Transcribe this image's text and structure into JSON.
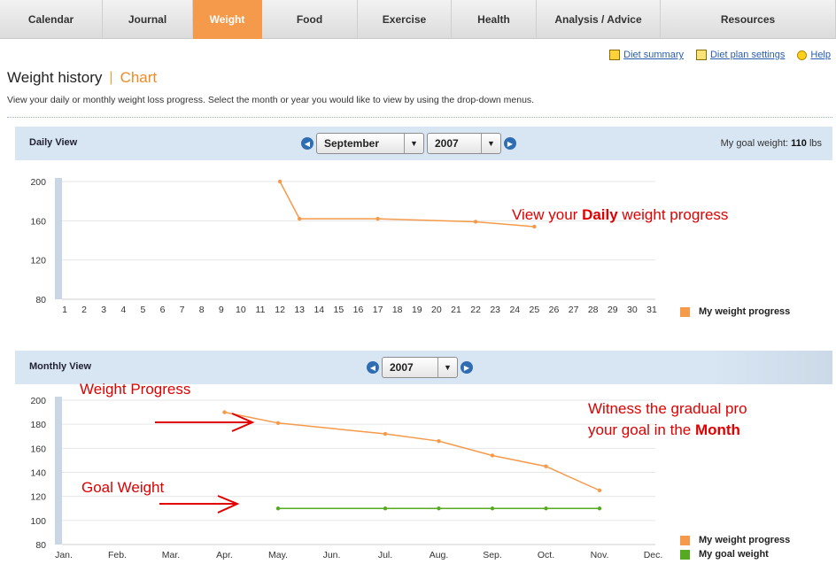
{
  "nav": {
    "tabs": [
      {
        "label": "Calendar",
        "active": false
      },
      {
        "label": "Journal",
        "active": false
      },
      {
        "label": "Weight",
        "active": true
      },
      {
        "label": "Food",
        "active": false
      },
      {
        "label": "Exercise",
        "active": false
      },
      {
        "label": "Health",
        "active": false
      },
      {
        "label": "Analysis / Advice",
        "active": false
      },
      {
        "label": "Resources",
        "active": false
      }
    ]
  },
  "links": {
    "diet_summary": "Diet summary",
    "diet_plan_settings": "Diet plan settings",
    "help": "Help"
  },
  "page": {
    "title": "Weight history",
    "subtitle": "Chart",
    "intro": "View your daily or monthly weight loss progress. Select the month or year you would like to view by using the drop-down menus."
  },
  "daily": {
    "label": "Daily View",
    "month": "September",
    "year": "2007",
    "goal_prefix": "My goal weight:",
    "goal_value": "110",
    "goal_unit": "lbs",
    "legend": "My weight progress"
  },
  "monthly": {
    "label": "Monthly View",
    "year": "2007",
    "legend_progress": "My weight progress",
    "legend_goal": "My goal weight"
  },
  "annotations": {
    "daily_pre": "View your ",
    "daily_bold": "Daily",
    "daily_post": " weight progress",
    "weight_progress": "Weight Progress",
    "goal_weight": "Goal Weight",
    "monthly_line1": "Witness the gradual pro",
    "monthly_pre": "your goal in the ",
    "monthly_bold": "Month"
  },
  "colors": {
    "progress": "#f59a4a",
    "goal": "#55aa22",
    "active_tab": "#f59a4a"
  },
  "chart_data": [
    {
      "type": "line",
      "name": "daily",
      "x_ticks": [
        1,
        2,
        3,
        4,
        5,
        6,
        7,
        8,
        9,
        10,
        11,
        12,
        13,
        14,
        15,
        16,
        17,
        18,
        19,
        20,
        21,
        22,
        23,
        24,
        25,
        26,
        27,
        28,
        29,
        30,
        31
      ],
      "y_ticks": [
        80,
        120,
        160,
        200
      ],
      "ylim": [
        80,
        200
      ],
      "series": [
        {
          "name": "My weight progress",
          "points": [
            [
              12,
              200
            ],
            [
              13,
              162
            ],
            [
              17,
              162
            ],
            [
              22,
              159
            ],
            [
              25,
              154
            ]
          ]
        }
      ]
    },
    {
      "type": "line",
      "name": "monthly",
      "categories": [
        "Jan.",
        "Feb.",
        "Mar.",
        "Apr.",
        "May.",
        "Jun.",
        "Jul.",
        "Aug.",
        "Sep.",
        "Oct.",
        "Nov.",
        "Dec."
      ],
      "y_ticks": [
        80,
        100,
        120,
        140,
        160,
        180,
        200
      ],
      "ylim": [
        80,
        200
      ],
      "series": [
        {
          "name": "My weight progress",
          "points": [
            [
              4,
              190
            ],
            [
              5,
              181
            ],
            [
              7,
              172
            ],
            [
              8,
              166
            ],
            [
              9,
              154
            ],
            [
              10,
              145
            ],
            [
              11,
              125
            ]
          ]
        },
        {
          "name": "My goal weight",
          "points": [
            [
              5,
              110
            ],
            [
              7,
              110
            ],
            [
              8,
              110
            ],
            [
              9,
              110
            ],
            [
              10,
              110
            ],
            [
              11,
              110
            ]
          ]
        }
      ]
    }
  ]
}
